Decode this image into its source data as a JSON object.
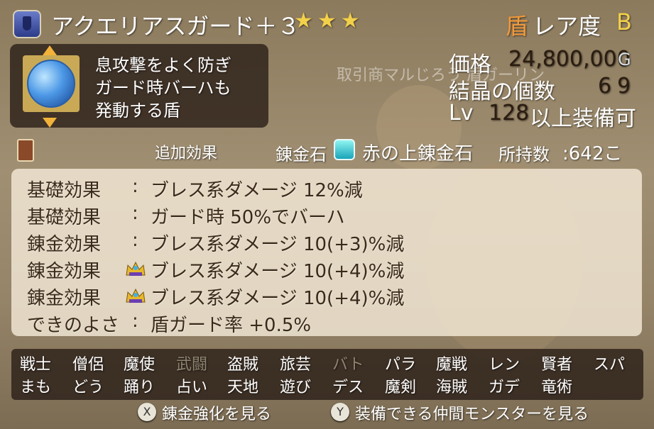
{
  "item": {
    "title": "アクエリアスガード＋３",
    "stars": "★★★",
    "category_kanji": "盾",
    "rarity_label": "レア度",
    "rarity_value": "B",
    "description": [
      "息攻撃をよく防ぎ",
      "ガード時バーハも",
      "発動する盾"
    ]
  },
  "trader": {
    "text": "取引商マルじろう 盾ガーリン"
  },
  "stats": {
    "price_label": "価格",
    "price_value": "24,800,000",
    "price_unit": "G",
    "crystal_label": "結晶の個数",
    "crystal_value": "69",
    "level_prefix": "Lv",
    "level_value": "128",
    "level_suffix": "以上装備可"
  },
  "alchemy": {
    "extra_effect_label": "追加効果",
    "stone_label": "錬金石",
    "stone_name": "赤の上錬金石",
    "owned_label": "所持数",
    "owned_value": ":642こ"
  },
  "effects": [
    {
      "label": "基礎効果",
      "colon": ":",
      "text": "ブレス系ダメージ 12%減"
    },
    {
      "label": "基礎効果",
      "colon": ":",
      "text": "ガード時 50%でバーハ"
    },
    {
      "label": "錬金効果",
      "colon": ":",
      "text": "ブレス系ダメージ 10(+3)%減"
    },
    {
      "label": "錬金効果",
      "colon": "",
      "text": "ブレス系ダメージ 10(+4)%減"
    },
    {
      "label": "錬金効果",
      "colon": "",
      "text": "ブレス系ダメージ 10(+4)%減"
    },
    {
      "label": "できのよさ",
      "colon": ":",
      "text": "盾ガード率 +0.5%"
    }
  ],
  "jobs_row1": [
    "戦士",
    "僧侶",
    "魔使",
    "武闘",
    "盗賊",
    "旅芸",
    "バト",
    "パラ",
    "魔戦",
    "レン",
    "賢者",
    "スパ"
  ],
  "jobs_row2": [
    "まも",
    "どう",
    "踊り",
    "占い",
    "天地",
    "遊び",
    "デス",
    "魔剣",
    "海賊",
    "ガデ",
    "竜術"
  ],
  "buttons": {
    "x_key": "X",
    "x_label": "錬金強化を見る",
    "y_key": "Y",
    "y_label": "装備できる仲間モンスターを見る"
  },
  "colors": {
    "accent_gold": "#f2d04a",
    "shield_orange": "#f29a3a",
    "job_disabled": "#8f8470"
  }
}
